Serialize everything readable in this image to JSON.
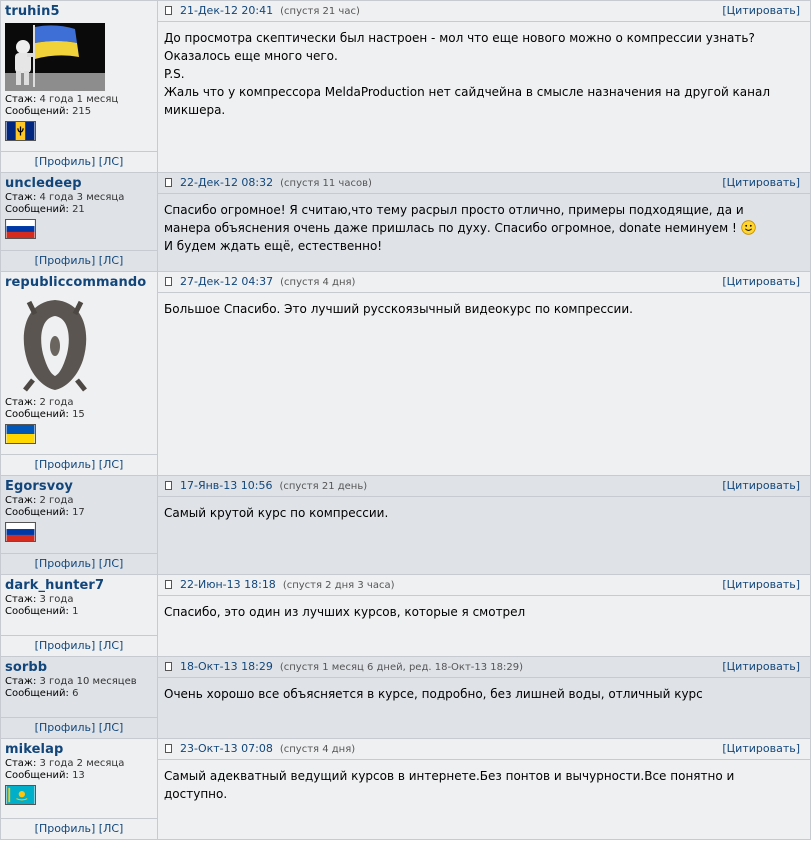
{
  "common": {
    "profile_label": "[Профиль]",
    "pm_label": "[ЛС]",
    "quote_label": "[Цитировать]",
    "exp_label": "Стаж:",
    "msgs_label": "Сообщений:"
  },
  "posts": [
    {
      "user": "truhin5",
      "experience": "4 года 1 месяц",
      "messages": "215",
      "avatar": "astronaut-with-ukrainian-flag",
      "flag": "barbados-flag",
      "date": "21-Дек-12 20:41",
      "ago": "(спустя 21 час)",
      "lines": [
        "До просмотра скептически был настроен - мол что еще нового можно о компрессии узнать?",
        "Оказалось еще много чего.",
        "P.S.",
        "Жаль что у компрессора MeldaProduction нет сайдчейна в смысле назначения на другой канал",
        "микшера."
      ]
    },
    {
      "user": "uncledeep",
      "experience": "4 года 3 месяца",
      "messages": "21",
      "flag": "russia-flag",
      "date": "22-Дек-12 08:32",
      "ago": "(спустя 11 часов)",
      "lines": [
        "Спасибо огромное! Я считаю,что тему расрыл просто отлично, примеры подходящие, да и",
        "манера объяснения очень даже пришлась по духу. Спасибо огромное, donate неминуем !",
        "И будем ждать ещё, естественно!"
      ]
    },
    {
      "user": "republiccommando",
      "experience": "2 года",
      "messages": "15",
      "avatar": "oblivion-sigil",
      "flag": "ukraine-flag",
      "date": "27-Дек-12 04:37",
      "ago": "(спустя 4 дня)",
      "lines": [
        "Большое Спасибо. Это лучший русскоязычный видеокурс по компрессии."
      ]
    },
    {
      "user": "Egorsvoy",
      "experience": "2 года",
      "messages": "17",
      "flag": "russia-flag",
      "date": "17-Янв-13 10:56",
      "ago": "(спустя 21 день)",
      "lines": [
        "Самый крутой курс по компрессии."
      ]
    },
    {
      "user": "dark_hunter7",
      "experience": "3 года",
      "messages": "1",
      "date": "22-Июн-13 18:18",
      "ago": "(спустя 2 дня 3 часа)",
      "lines": [
        "Спасибо, это один из лучших курсов, которые я смотрел"
      ]
    },
    {
      "user": "sorbb",
      "experience": "3 года 10 месяцев",
      "messages": "6",
      "date": "18-Окт-13 18:29",
      "ago": "(спустя 1 месяц 6 дней, ред. 18-Окт-13 18:29)",
      "lines": [
        "Очень хорошо все объясняется в курсе, подробно, без лишней воды, отличный курс"
      ]
    },
    {
      "user": "mikelap",
      "experience": "3 года 2 месяца",
      "messages": "13",
      "flag": "kazakhstan-flag",
      "date": "23-Окт-13 07:08",
      "ago": "(спустя 4 дня)",
      "lines": [
        "Самый адекватный ведущий курсов в интернете.Без понтов и вычурности.Все понятно и",
        "доступно."
      ]
    }
  ]
}
